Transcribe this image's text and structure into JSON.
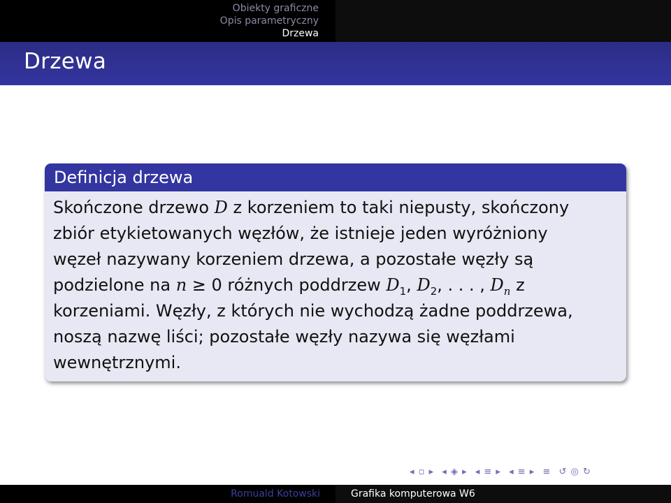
{
  "header": {
    "sections": [
      "Obiekty graficzne",
      "Opis parametryczny",
      "Drzewa"
    ],
    "active_section": "Drzewa"
  },
  "frame": {
    "title": "Drzewa"
  },
  "definition": {
    "title": "Definicja drzewa",
    "lines": [
      {
        "text": "Skończone drzewo ",
        "math": "D",
        "rest": " z korzeniem to taki niepusty, skończony"
      },
      "zbiór etykietowanych węzłów, że istnieje jeden wyróżniony",
      "węzeł nazywany korzeniem drzewa, a pozostałe węzły są",
      {
        "pre": "podzielone na ",
        "math_n": "n",
        "ge": " ≥ 0 ",
        "mid": "różnych poddrzew ",
        "d1": "D",
        "s1": "1",
        "d2": "D",
        "s2": "2",
        "dots": ", . . . , ",
        "dn": "D",
        "sn": "n",
        "post": " z"
      },
      "korzeniami. Węzły, z których nie wychodzą żadne poddrzewa,",
      "noszą nazwę liści; pozostałe węzły nazywa się węzłami",
      "wewnętrznymi."
    ]
  },
  "footer": {
    "author": "Romuald Kotowski",
    "course": "Grafika komputerowa W6"
  },
  "nav_symbols": [
    "◂ ▫ ▸",
    "◂ ◈ ▸",
    "◂ ≡ ▸",
    "◂ ≡ ▸",
    "≡",
    "↺ ◎ ↻"
  ],
  "colors": {
    "structure": "#3335a0",
    "block_body": "#e8e8f4",
    "header_bg": "#000000"
  }
}
